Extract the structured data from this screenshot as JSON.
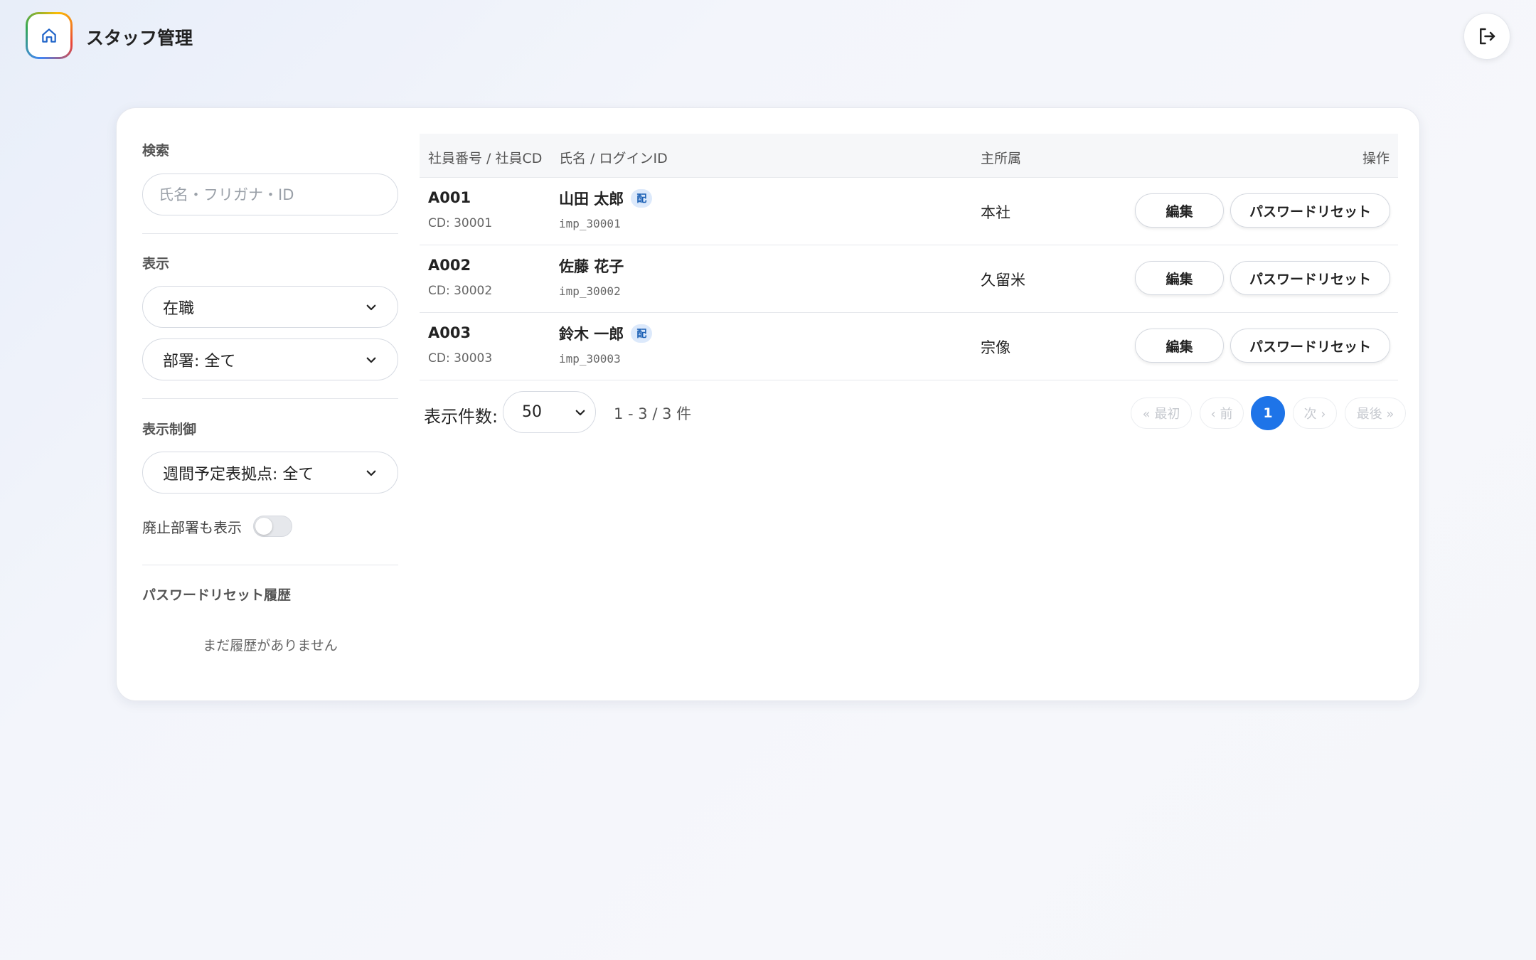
{
  "header": {
    "title": "スタッフ管理",
    "home_icon": "home-icon",
    "logout_icon": "logout-icon"
  },
  "sidebar": {
    "search": {
      "label": "検索",
      "placeholder": "氏名・フリガナ・ID",
      "value": ""
    },
    "display": {
      "label": "表示",
      "status_select": "在職",
      "department_select": "部署: 全て"
    },
    "display_control": {
      "label": "表示制御",
      "weekly_base_select": "週間予定表拠点: 全て",
      "show_abolished_label": "廃止部署も表示",
      "show_abolished": false
    },
    "password_history": {
      "label": "パスワードリセット履歴",
      "empty_text": "まだ履歴がありません"
    }
  },
  "table": {
    "headers": {
      "id": "社員番号 / 社員CD",
      "name": "氏名 / ログインID",
      "dept": "主所属",
      "ops": "操作"
    },
    "rows": [
      {
        "emp_no": "A001",
        "cd": "CD: 30001",
        "name": "山田 太郎",
        "badge": "配",
        "login": "imp_30001",
        "dept": "本社"
      },
      {
        "emp_no": "A002",
        "cd": "CD: 30002",
        "name": "佐藤 花子",
        "badge": "",
        "login": "imp_30002",
        "dept": "久留米"
      },
      {
        "emp_no": "A003",
        "cd": "CD: 30003",
        "name": "鈴木 一郎",
        "badge": "配",
        "login": "imp_30003",
        "dept": "宗像"
      }
    ],
    "edit_label": "編集",
    "reset_label": "パスワードリセット"
  },
  "pagination": {
    "per_page_label": "表示件数:",
    "per_page_value": "50",
    "range_text": "1 - 3 / 3 件",
    "first": "« 最初",
    "prev": "‹ 前",
    "current": "1",
    "next": "次 ›",
    "last": "最後 »"
  },
  "colors": {
    "accent": "#1e74e8",
    "badge_bg": "#dce9fb",
    "badge_text": "#1a5fb4"
  }
}
